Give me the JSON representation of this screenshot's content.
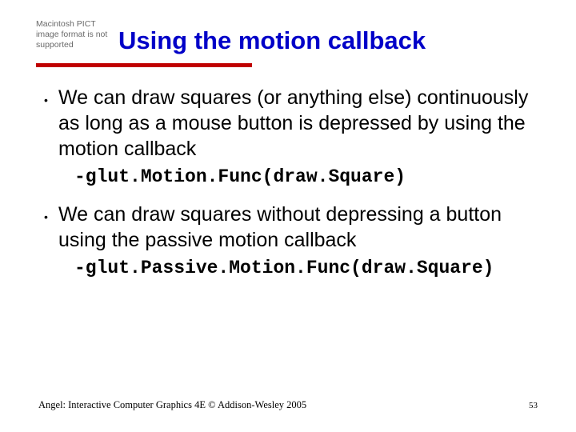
{
  "header": {
    "pict_placeholder": "Macintosh PICT image format is not supported",
    "title": "Using the motion callback"
  },
  "bullets": [
    {
      "text": "We can draw squares (or anything else) continuously as long as a mouse button is depressed by using the motion callback",
      "code": "-glut.Motion.Func(draw.Square)"
    },
    {
      "text": "We can draw squares without depressing a button using the passive motion callback",
      "code": "-glut.Passive.Motion.Func(draw.Square)"
    }
  ],
  "footer": {
    "citation": "Angel: Interactive Computer Graphics 4E © Addison-Wesley 2005",
    "page": "53"
  }
}
